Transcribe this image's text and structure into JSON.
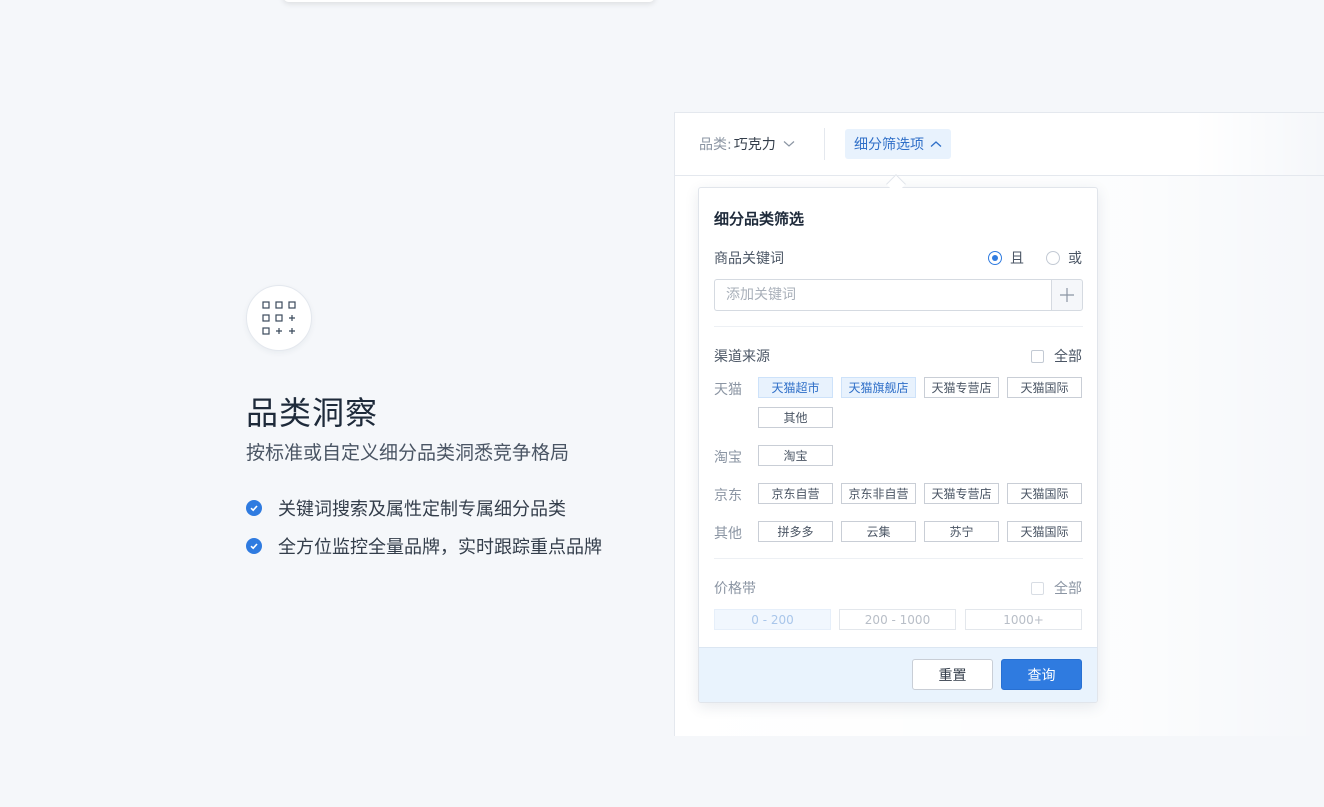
{
  "feature": {
    "icon": "category-grid-icon",
    "title": "品类洞察",
    "subtitle": "按标准或自定义细分品类洞悉竞争格局",
    "bullets": [
      "关键词搜索及属性定制专属细分品类",
      "全方位监控全量品牌，实时跟踪重点品牌"
    ]
  },
  "toolbar": {
    "category_label": "品类:",
    "category_value": "巧克力",
    "filter_button": "细分筛选项"
  },
  "dropdown": {
    "title": "细分品类筛选",
    "keyword": {
      "label": "商品关键词",
      "mode_and": "且",
      "mode_or": "或",
      "selected_mode": "且",
      "placeholder": "添加关键词",
      "value": ""
    },
    "channel": {
      "label": "渠道来源",
      "all_label": "全部",
      "groups": [
        {
          "name": "天猫",
          "tags": [
            "天猫超市",
            "天猫旗舰店",
            "天猫专营店",
            "天猫国际",
            "其他"
          ],
          "selected": [
            "天猫超市",
            "天猫旗舰店"
          ]
        },
        {
          "name": "淘宝",
          "tags": [
            "淘宝"
          ],
          "selected": []
        },
        {
          "name": "京东",
          "tags": [
            "京东自营",
            "京东非自营",
            "天猫专营店",
            "天猫国际"
          ],
          "selected": []
        },
        {
          "name": "其他",
          "tags": [
            "拼多多",
            "云集",
            "苏宁",
            "天猫国际"
          ],
          "selected": []
        }
      ]
    },
    "price": {
      "label": "价格带",
      "all_label": "全部",
      "ranges": [
        "0 - 200",
        "200 - 1000",
        "1000+"
      ],
      "selected": "0 - 200"
    },
    "reset_label": "重置",
    "query_label": "查询"
  },
  "colors": {
    "accent": "#2f7be0",
    "selected_tag_bg": "#e8f2fd",
    "footer_bg": "#e9f3fd"
  }
}
